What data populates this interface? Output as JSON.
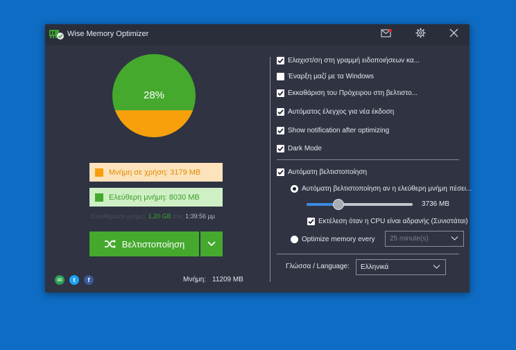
{
  "app": {
    "title": "Wise Memory Optimizer"
  },
  "titlebar": {
    "mail_icon": "mail-icon",
    "settings_icon": "gear-icon",
    "close_icon": "close-icon"
  },
  "colors": {
    "used": "#f7a00c",
    "free": "#45a92e",
    "accent": "#3d8be0"
  },
  "memory": {
    "percent": 28,
    "percent_label": "28%",
    "used_label": "Μνήμη σε χρήση: 3179 MB",
    "free_label": "Ελεύθερη μνήμη: 8030 MB",
    "last_freed_prefix": "Ελευθέρωσε μνήμη:",
    "last_freed_value": "1,20 GB",
    "last_time_prefix": "στις",
    "last_time_value": "1:39:56 μμ",
    "total_label": "Μνήμη:",
    "total_value": "11209 MB"
  },
  "optimize": {
    "label": "Βελτιστοποίηση"
  },
  "social": [
    {
      "name": "email",
      "glyph": "✉",
      "color": "#2aa052"
    },
    {
      "name": "twitter",
      "glyph": "t",
      "color": "#1da1f2"
    },
    {
      "name": "facebook",
      "glyph": "f",
      "color": "#3b5998"
    }
  ],
  "settings": {
    "checkboxes": [
      {
        "label": "Ελαχιστ/ση στη γραμμή ειδοποιήσεων κα...",
        "checked": true
      },
      {
        "label": "Έναρξη μαζί με τα Windows",
        "checked": false
      },
      {
        "label": "Εκκαθάριση του Πρόχειρου στη βελτιστο...",
        "checked": true
      },
      {
        "label": "Αυτόματος έλεγχος για νέα έκδοση",
        "checked": true
      },
      {
        "label": "Show notification after optimizing",
        "checked": true
      },
      {
        "label": "Dark Mode",
        "checked": true
      }
    ],
    "auto_optimize": {
      "label": "Αυτόματη βελτιστοποίηση",
      "checked": true
    },
    "radio_free_mem": {
      "label": "Αυτόματη βελτιστοποίηση αν η ελεύθερη μνήμη πέσει...",
      "selected": true
    },
    "threshold": {
      "value": "3736 MB",
      "fraction": 0.3
    },
    "cpu_idle": {
      "label": "Εκτέλεση όταν η CPU είναι αδρανής (Συνιστάται)",
      "checked": true
    },
    "radio_every": {
      "label": "Optimize memory every",
      "selected": false
    },
    "interval": {
      "value": "25 minute(s)"
    },
    "language": {
      "label": "Γλώσσα / Language:",
      "value": "Ελληνικά"
    }
  }
}
